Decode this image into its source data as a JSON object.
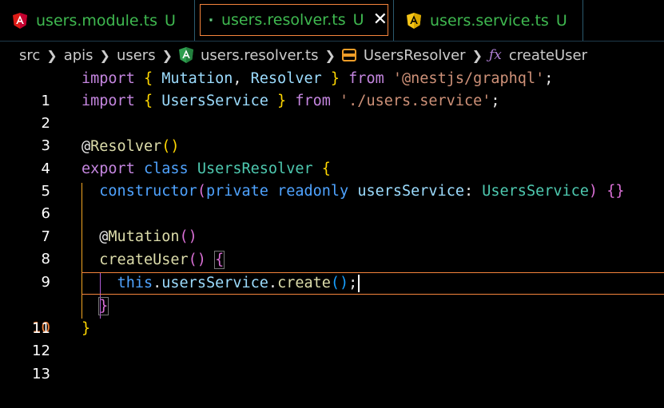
{
  "tabs": [
    {
      "label": "users.module.ts",
      "status": "U",
      "icon": "angular-icon",
      "icon_color": "#dd1b16",
      "active": false
    },
    {
      "label": "users.resolver.ts",
      "status": "U",
      "icon": "angular-resolver-icon",
      "icon_color": "#2e9e4e",
      "active": true,
      "close": "✕"
    },
    {
      "label": "users.service.ts",
      "status": "U",
      "icon": "angular-service-icon",
      "icon_color": "#f5c518",
      "active": false
    }
  ],
  "breadcrumb": {
    "items": [
      "src",
      "apis",
      "users",
      "users.resolver.ts",
      "UsersResolver",
      "createUser"
    ],
    "symbol_class_icon": "class-symbol-icon",
    "symbol_fn_icon": "function-symbol-icon",
    "fn_glyph": "ƒx"
  },
  "editor": {
    "current_line": 10,
    "line_numbers": [
      "1",
      "2",
      "3",
      "4",
      "5",
      "6",
      "7",
      "8",
      "9",
      "10",
      "11",
      "12",
      "13"
    ],
    "lines": [
      "import { Mutation, Resolver } from '@nestjs/graphql';",
      "import { UsersService } from './users.service';",
      "",
      "@Resolver()",
      "export class UsersResolver {",
      "  constructor(private readonly usersService: UsersService) {}",
      "",
      "  @Mutation()",
      "  createUser() {",
      "    this.usersService.create();",
      "  }",
      "}",
      ""
    ]
  },
  "colors": {
    "accent": "#f5843c",
    "tab_text": "#3fb950",
    "keyword": "#c586e0",
    "storage": "#4fa3ff",
    "function": "#dcdcaa",
    "variable": "#9cdcfe",
    "class": "#4ec9b0",
    "string": "#ce9178"
  }
}
